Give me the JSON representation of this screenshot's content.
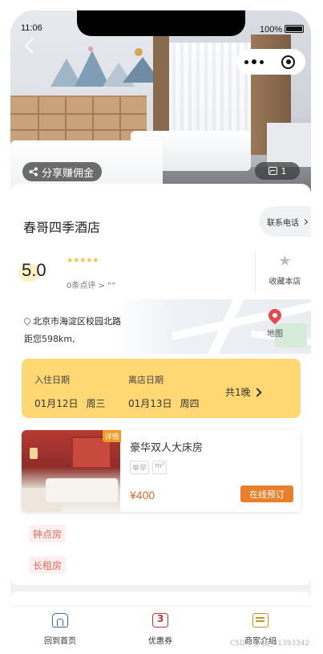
{
  "status_bar": {
    "time": "11:06",
    "battery": "100%"
  },
  "hero": {
    "share_label": "分享赚佣金",
    "photo_count": "1"
  },
  "hotel": {
    "name": "春哥四季酒店",
    "contact_label": "联系电话",
    "score": "5.0",
    "stars": "★★★★★",
    "reviews": "0条点评 > “”",
    "favorite_label": "收藏本店",
    "address": "北京市海淀区校园北路",
    "distance": "距您598km,",
    "map_label": "地图"
  },
  "dates": {
    "checkin_label": "入住日期",
    "checkin_date": "01月12日",
    "checkin_weekday": "周三",
    "checkout_label": "离店日期",
    "checkout_date": "01月13日",
    "checkout_weekday": "周四",
    "nights": "共1晚"
  },
  "room": {
    "detail_tag": "详情",
    "title": "豪华双人大床房",
    "tags": [
      "单早",
      "m²"
    ],
    "price": "¥400",
    "book_label": "在线预订"
  },
  "room_types": [
    "钟点房",
    "长租房"
  ],
  "tabbar": [
    {
      "label": "回到首页",
      "icon": "home-icon"
    },
    {
      "label": "优惠券",
      "icon": "coupon-icon"
    },
    {
      "label": "商家介绍",
      "icon": "store-intro-icon"
    }
  ],
  "watermark": "CSDN @qq_31393342",
  "colors": {
    "accent_yellow": "#ffd874",
    "book_orange": "#e87f2a",
    "price_orange": "#e06a2a",
    "pill_text": "#e06a63"
  }
}
